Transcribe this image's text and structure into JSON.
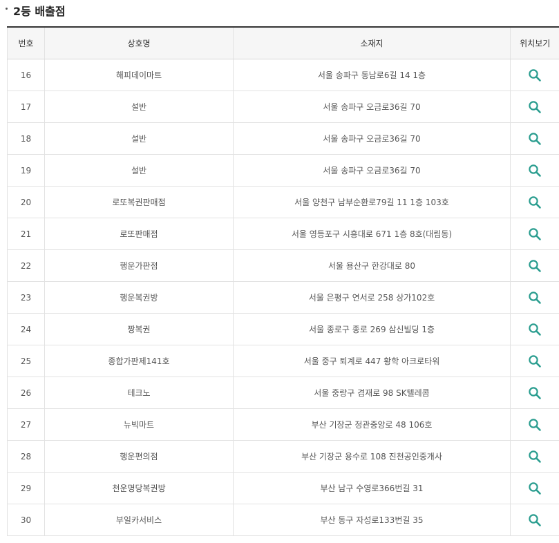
{
  "section": {
    "title": "2등 배출점"
  },
  "table": {
    "headers": {
      "number": "번호",
      "store_name": "상호명",
      "address": "소재지",
      "view_location": "위치보기"
    },
    "rows": [
      {
        "number": "16",
        "store_name": "해피데이마트",
        "address": "서울 송파구 동남로6길 14 1층"
      },
      {
        "number": "17",
        "store_name": "설반",
        "address": "서울 송파구 오금로36길 70"
      },
      {
        "number": "18",
        "store_name": "설반",
        "address": "서울 송파구 오금로36길 70"
      },
      {
        "number": "19",
        "store_name": "설반",
        "address": "서울 송파구 오금로36길 70"
      },
      {
        "number": "20",
        "store_name": "로또복권판매점",
        "address": "서울 양천구 남부순환로79길 11 1층 103호"
      },
      {
        "number": "21",
        "store_name": "로또판매점",
        "address": "서울 영등포구 시흥대로 671 1층 8호(대림동)"
      },
      {
        "number": "22",
        "store_name": "행운가판점",
        "address": "서울 용산구 한강대로 80"
      },
      {
        "number": "23",
        "store_name": "행운복권방",
        "address": "서울 은평구 연서로 258 상가102호"
      },
      {
        "number": "24",
        "store_name": "짱복권",
        "address": "서울 종로구 종로 269 삼신빌딩 1층"
      },
      {
        "number": "25",
        "store_name": "종합가판제141호",
        "address": "서울 중구 퇴계로 447 황학 아크로타워"
      },
      {
        "number": "26",
        "store_name": "테크노",
        "address": "서울 중랑구 겸재로 98 SK텔레콤"
      },
      {
        "number": "27",
        "store_name": "뉴빅마트",
        "address": "부산 기장군 정관중앙로 48 106호"
      },
      {
        "number": "28",
        "store_name": "행운편의점",
        "address": "부산 기장군 용수로 108 진천공인중개사"
      },
      {
        "number": "29",
        "store_name": "천운명당복권방",
        "address": "부산 남구 수영로366번길 31"
      },
      {
        "number": "30",
        "store_name": "부일카서비스",
        "address": "부산 동구 자성로133번길 35"
      }
    ]
  },
  "icons": {
    "view_location": "search-icon"
  },
  "colors": {
    "search_icon": "#2a9d8f"
  }
}
